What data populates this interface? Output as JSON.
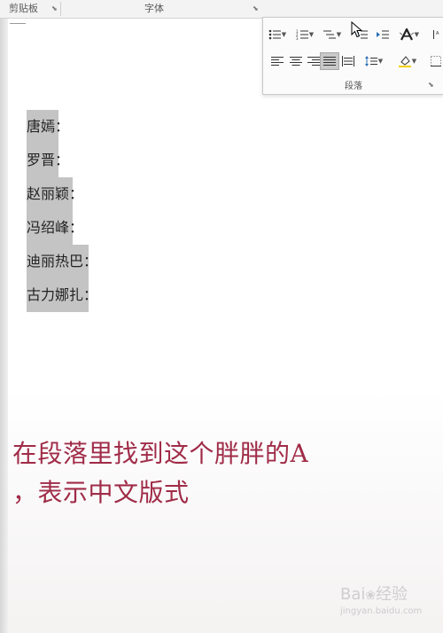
{
  "ribbon": {
    "clipboard_label": "剪贴板",
    "font_label": "字体"
  },
  "paragraph_panel": {
    "label": "段落"
  },
  "document": {
    "names": [
      "唐嫣：",
      "罗晋：",
      "赵丽颖：",
      "冯绍峰：",
      "迪丽热巴：",
      "古力娜扎："
    ]
  },
  "caption": {
    "line1": "在段落里找到这个胖胖的A",
    "line2": "，表示中文版式"
  },
  "watermark": {
    "brand": "Bai",
    "brand2": "经验",
    "site": "jingyan.baidu.com"
  },
  "colors": {
    "caption": "#a02c48",
    "highlight": "#c4c4c4"
  }
}
